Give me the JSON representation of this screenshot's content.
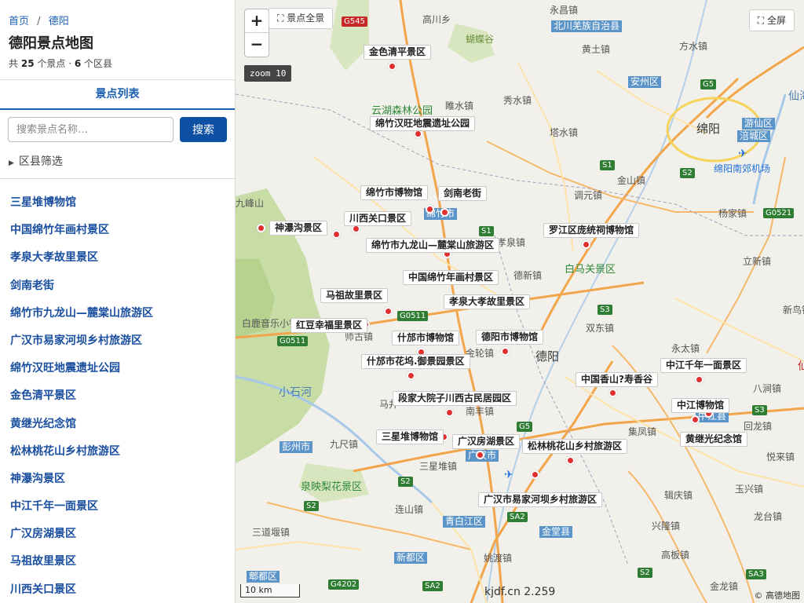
{
  "sidebar": {
    "breadcrumb": {
      "home": "首页",
      "separator": "/",
      "current": "德阳"
    },
    "title": "德阳景点地图",
    "summary": {
      "prefix": "共",
      "spots": "25",
      "spots_unit": "个景点 ·",
      "districts": "6",
      "districts_unit": "个区县"
    },
    "tab_label": "景点列表",
    "search": {
      "placeholder": "搜索景点名称…",
      "button": "搜索"
    },
    "filter_label": "区县筛选",
    "spots": [
      "三星堆博物馆",
      "中国绵竹年画村景区",
      "孝泉大孝故里景区",
      "剑南老街",
      "绵竹市九龙山—麓棠山旅游区",
      "广汉市易家河坝乡村旅游区",
      "绵竹汉旺地震遗址公园",
      "金色清平景区",
      "黄继光纪念馆",
      "松林桃花山乡村旅游区",
      "神瀑沟景区",
      "中江千年一面景区",
      "广汉房湖景区",
      "马祖故里景区",
      "川西关口景区"
    ]
  },
  "map": {
    "zoom_in": "+",
    "zoom_out": "−",
    "full_view": "景点全景",
    "fullscreen": "全屏",
    "zoom_level": "zoom 10",
    "scale": "10 km",
    "watermark": "kjdf.cn 2.259",
    "attribution": "© 高德地图",
    "poi_labels": [
      "金色清平景区",
      "绵竹汉旺地震遗址公园",
      "绵竹市博物馆",
      "剑南老街",
      "川西关口景区",
      "神瀑沟景区",
      "绵竹市九龙山—麓棠山旅游区",
      "罗江区庞统祠博物馆",
      "中国绵竹年画村景区",
      "马祖故里景区",
      "孝泉大孝故里景区",
      "红豆幸福里景区",
      "什邡市博物馆",
      "德阳市博物馆",
      "什邡市花坞.御景园景区",
      "中国香山?寿香谷",
      "中江千年一面景区",
      "段家大院子川西古民居园区",
      "中江博物馆",
      "三星堆博物馆",
      "广汉房湖景区",
      "松林桃花山乡村旅游区",
      "黄继光纪念馆",
      "广汉市易家河坝乡村旅游区"
    ],
    "place_names": [
      "永昌镇",
      "高川乡",
      "蝴蝶谷",
      "黄土镇",
      "方水镇",
      "睢水镇",
      "秀水镇",
      "塔水镇",
      "金山镇",
      "调元镇",
      "杨家镇",
      "九峰山",
      "孝泉镇",
      "立新镇",
      "德新镇",
      "双东镇",
      "新鸟镇",
      "永太镇",
      "八涧镇",
      "师古镇",
      "金轮镇",
      "马井",
      "南丰镇",
      "集凤镇",
      "回龙镇",
      "九尺镇",
      "悦来镇",
      "三星堆镇",
      "辑庆镇",
      "玉兴镇",
      "连山镇",
      "兴隆镇",
      "三道堰镇",
      "姚渡镇",
      "高板镇",
      "龙台镇",
      "金龙镇",
      "小石河",
      "白鹿音乐小镇",
      "泉映梨花景区",
      "白马关景区",
      "云湖森林公园",
      "仙海",
      "仙"
    ],
    "city_names": [
      "绵阳",
      "德阳"
    ],
    "district_tags": [
      "北川羌族自治县",
      "安州区",
      "游仙区",
      "涪城区",
      "广汉市",
      "彭州市",
      "中江县",
      "青白江区",
      "金堂县",
      "新都区",
      "郫都区",
      "绵竹市"
    ],
    "airports": [
      "绵阳南郊机场",
      "广汉机场"
    ],
    "highways": [
      "G545",
      "G5",
      "S1",
      "G0521",
      "S1",
      "G0511",
      "G0511",
      "G5",
      "S3",
      "S2",
      "S2",
      "S2",
      "G4202",
      "S3",
      "S2",
      "SA3",
      "SA2",
      "SA2"
    ],
    "colors": {
      "poi_marker": "#e03030",
      "district_tag": "#5b94c8",
      "button": "#0d4fa3",
      "link": "#1a5fb4"
    }
  }
}
